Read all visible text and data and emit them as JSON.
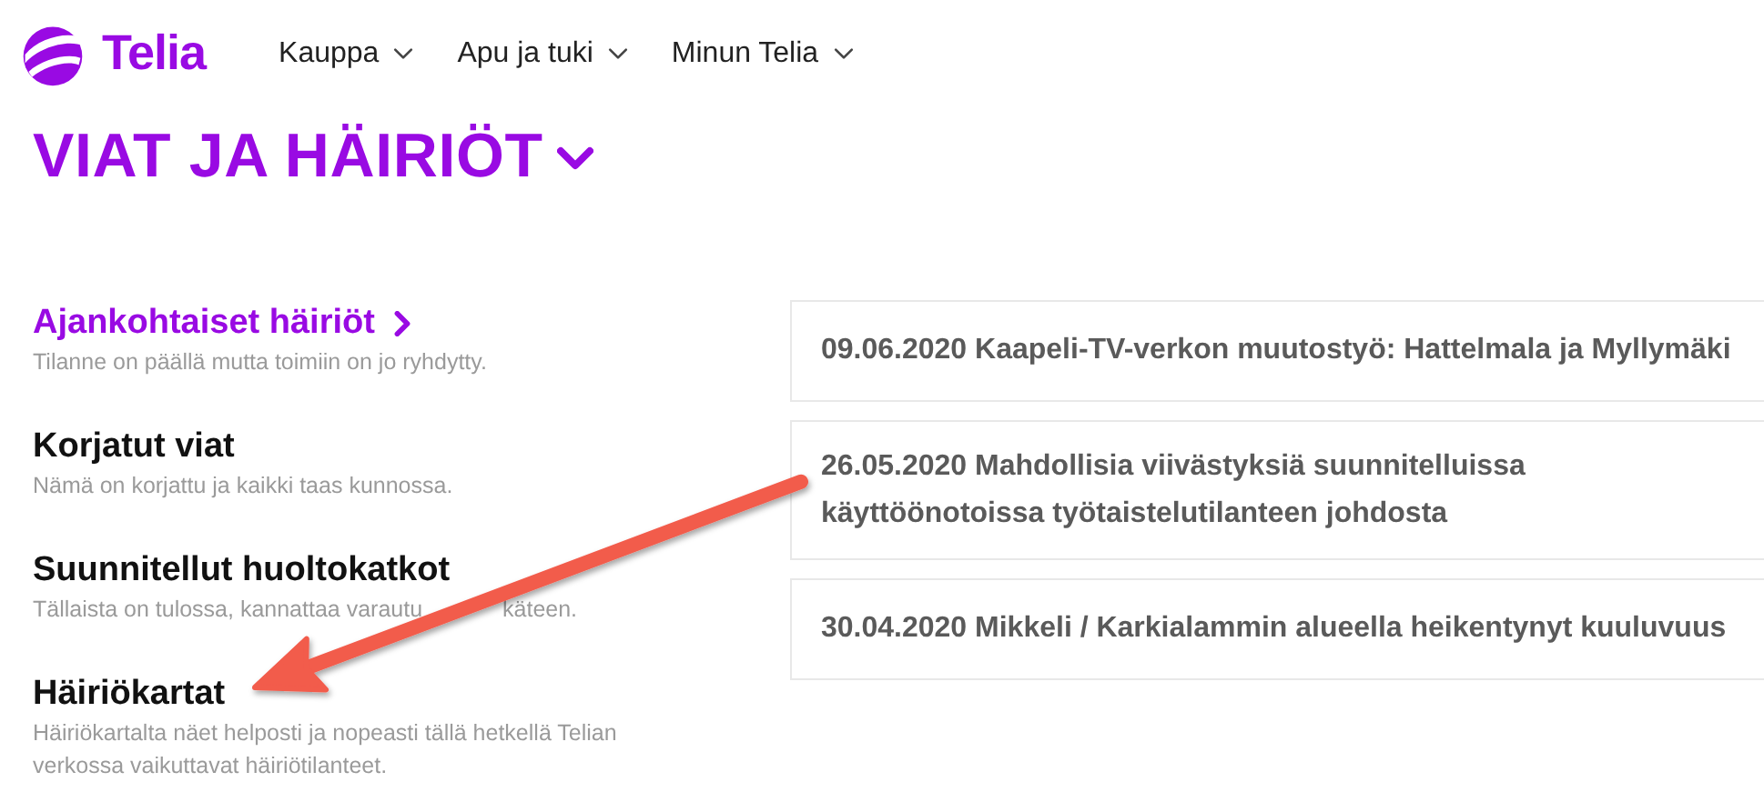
{
  "header": {
    "logo": "Telia",
    "nav": [
      "Kauppa",
      "Apu ja tuki",
      "Minun Telia"
    ]
  },
  "page_title": "VIAT JA HÄIRIÖT",
  "categories": [
    {
      "title": "Ajankohtaiset häiriöt",
      "description": "Tilanne on päällä mutta toimiin on jo ryhdytty.",
      "selected": true
    },
    {
      "title": "Korjatut viat",
      "description": "Nämä on korjattu ja kaikki taas kunnossa.",
      "selected": false
    },
    {
      "title": "Suunnitellut huoltokatkot",
      "description_parts": [
        "Tällaista on tulossa, kannattaa varautu",
        "käteen."
      ],
      "selected": false
    },
    {
      "title": "Häiriökartat",
      "description": "Häiriökartalta näet helposti ja nopeasti tällä hetkellä Telian verkossa vaikuttavat häiriötilanteet.",
      "selected": false
    }
  ],
  "notices": [
    "09.06.2020 Kaapeli-TV-verkon muutostyö: Hattelmala ja Myllymäki",
    "26.05.2020 Mahdollisia viivästyksiä suunnitelluissa käyttöönotoissa työtaistelutilanteen johdosta",
    "30.04.2020 Mikkeli / Karkialammin alueella heikentynyt kuuluvuus"
  ],
  "annotation": {
    "kind": "arrow",
    "color": "#f25b4c"
  }
}
